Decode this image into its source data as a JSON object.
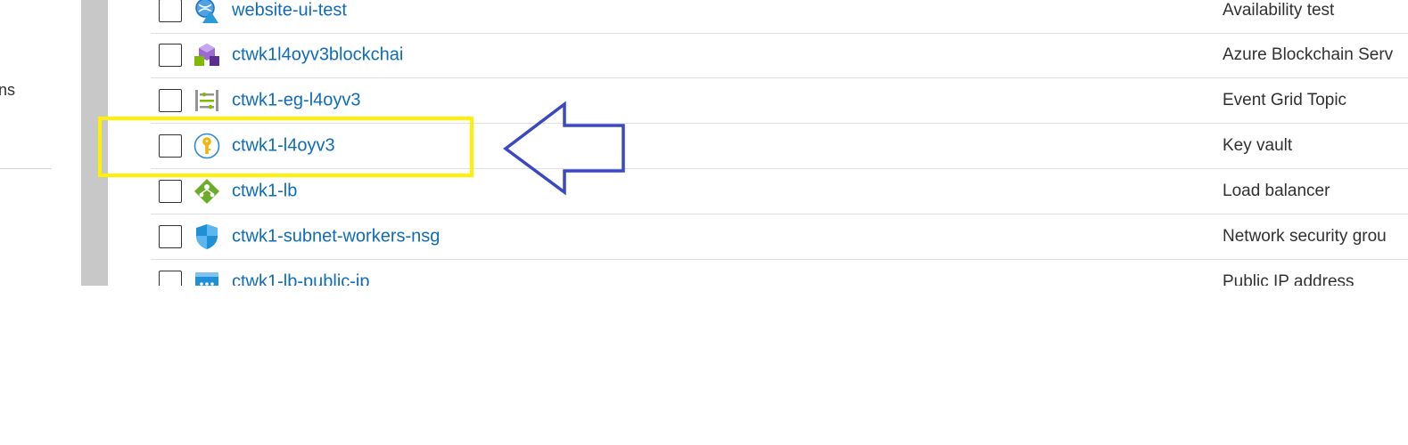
{
  "sidebar": {
    "partial_label": "ns"
  },
  "resources": [
    {
      "name": "website-ui-test",
      "type": "Availability test",
      "icon": "availability-test-icon"
    },
    {
      "name": "ctwk1l4oyv3blockchai",
      "type": "Azure Blockchain Serv",
      "icon": "blockchain-service-icon"
    },
    {
      "name": "ctwk1-eg-l4oyv3",
      "type": "Event Grid Topic",
      "icon": "event-grid-topic-icon"
    },
    {
      "name": "ctwk1-l4oyv3",
      "type": "Key vault",
      "icon": "key-vault-icon"
    },
    {
      "name": "ctwk1-lb",
      "type": "Load balancer",
      "icon": "load-balancer-icon"
    },
    {
      "name": "ctwk1-subnet-workers-nsg",
      "type": "Network security grou",
      "icon": "network-security-group-icon"
    },
    {
      "name": "ctwk1-lb-public-ip",
      "type": "Public IP address",
      "icon": "public-ip-address-icon"
    }
  ],
  "annotation": {
    "highlight_color": "#fff200",
    "arrow_color": "#3b48c4",
    "highlighted_resource": "ctwk1-l4oyv3"
  },
  "colors": {
    "link": "#0f6cbd",
    "text": "#323130",
    "gutter": "#c8c8c8",
    "row_border": "#e1dfdd"
  }
}
